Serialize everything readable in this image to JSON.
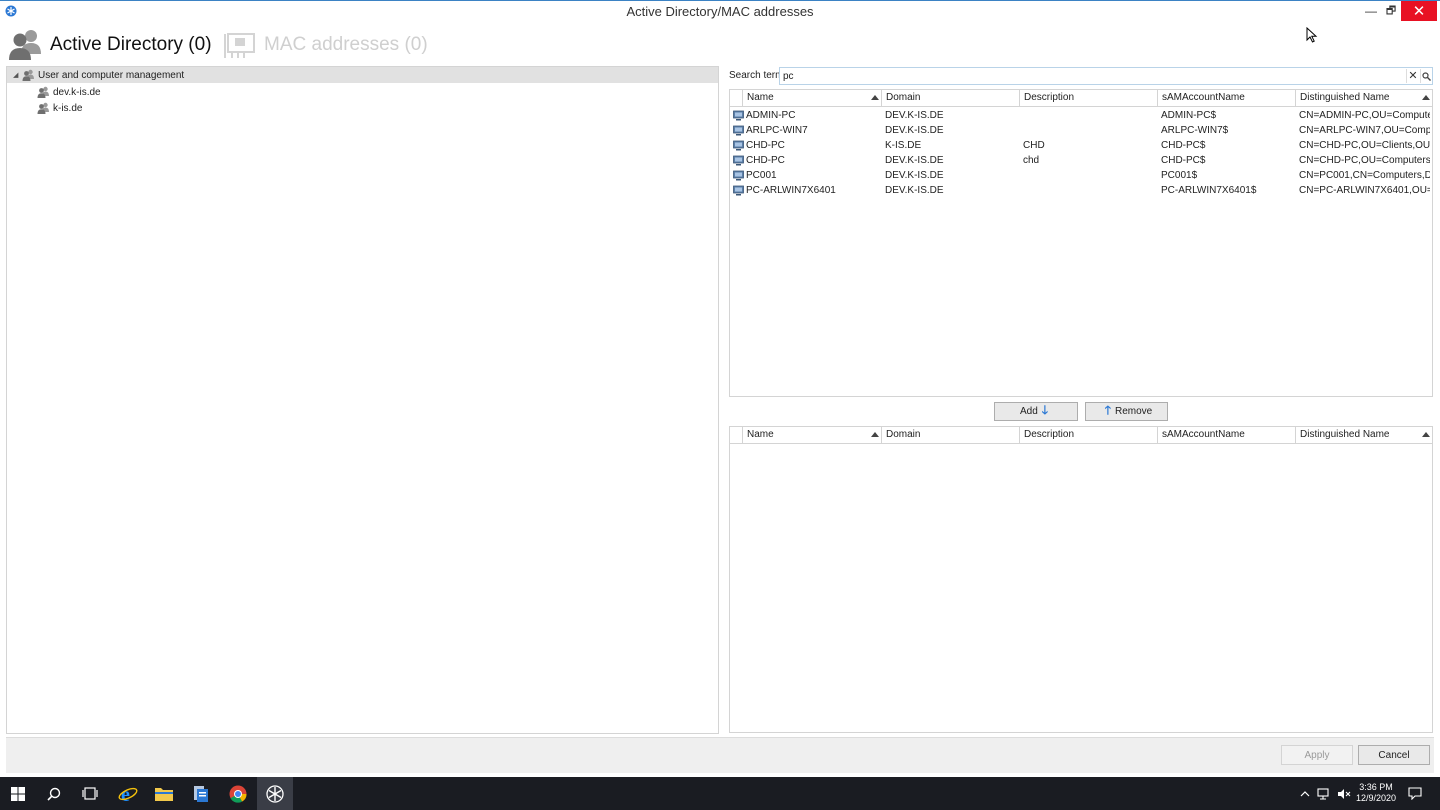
{
  "window": {
    "title": "Active Directory/MAC addresses",
    "minimize_glyph": "—",
    "maximize_glyph": "🗗",
    "close_glyph": "✕"
  },
  "tabs": [
    {
      "label": "Active Directory (0)",
      "icon": "users-icon",
      "active": true
    },
    {
      "label": "MAC addresses (0)",
      "icon": "network-card-icon",
      "active": false
    }
  ],
  "tree": {
    "root": {
      "label": "User and computer management",
      "expanded": true
    },
    "children": [
      {
        "label": "dev.k-is.de"
      },
      {
        "label": "k-is.de"
      }
    ]
  },
  "search": {
    "label": "Search term",
    "value": "pc",
    "clear_glyph": "✕"
  },
  "results_grid": {
    "columns": [
      "Name",
      "Domain",
      "Description",
      "sAMAccountName",
      "Distinguished Name"
    ],
    "rows": [
      {
        "name": "ADMIN-PC",
        "domain": "DEV.K-IS.DE",
        "description": "",
        "sam": "ADMIN-PC$",
        "dn": "CN=ADMIN-PC,OU=Computer..."
      },
      {
        "name": "ARLPC-WIN7",
        "domain": "DEV.K-IS.DE",
        "description": "",
        "sam": "ARLPC-WIN7$",
        "dn": "CN=ARLPC-WIN7,OU=Comput..."
      },
      {
        "name": "CHD-PC",
        "domain": "K-IS.DE",
        "description": "CHD",
        "sam": "CHD-PC$",
        "dn": "CN=CHD-PC,OU=Clients,OU=C..."
      },
      {
        "name": "CHD-PC",
        "domain": "DEV.K-IS.DE",
        "description": "chd",
        "sam": "CHD-PC$",
        "dn": "CN=CHD-PC,OU=Computers-..."
      },
      {
        "name": "PC001",
        "domain": "DEV.K-IS.DE",
        "description": "",
        "sam": "PC001$",
        "dn": "CN=PC001,CN=Computers,DC..."
      },
      {
        "name": "PC-ARLWIN7X6401",
        "domain": "DEV.K-IS.DE",
        "description": "",
        "sam": "PC-ARLWIN7X6401$",
        "dn": "CN=PC-ARLWIN7X6401,OU=C..."
      }
    ]
  },
  "actions": {
    "add_label": "Add",
    "remove_label": "Remove"
  },
  "selected_grid": {
    "columns": [
      "Name",
      "Domain",
      "Description",
      "sAMAccountName",
      "Distinguished Name"
    ],
    "rows": []
  },
  "footer": {
    "apply_label": "Apply",
    "apply_enabled": false,
    "cancel_label": "Cancel"
  },
  "taskbar": {
    "items": [
      "windows-start-icon",
      "search-icon",
      "task-view-icon",
      "internet-explorer-icon",
      "file-explorer-icon",
      "server-manager-icon",
      "chrome-icon",
      "app-icon"
    ],
    "time": "3:36 PM",
    "date": "12/9/2020"
  },
  "colors": {
    "accent": "#2b78d4",
    "close": "#e81123",
    "taskbar": "#1a1c22"
  }
}
